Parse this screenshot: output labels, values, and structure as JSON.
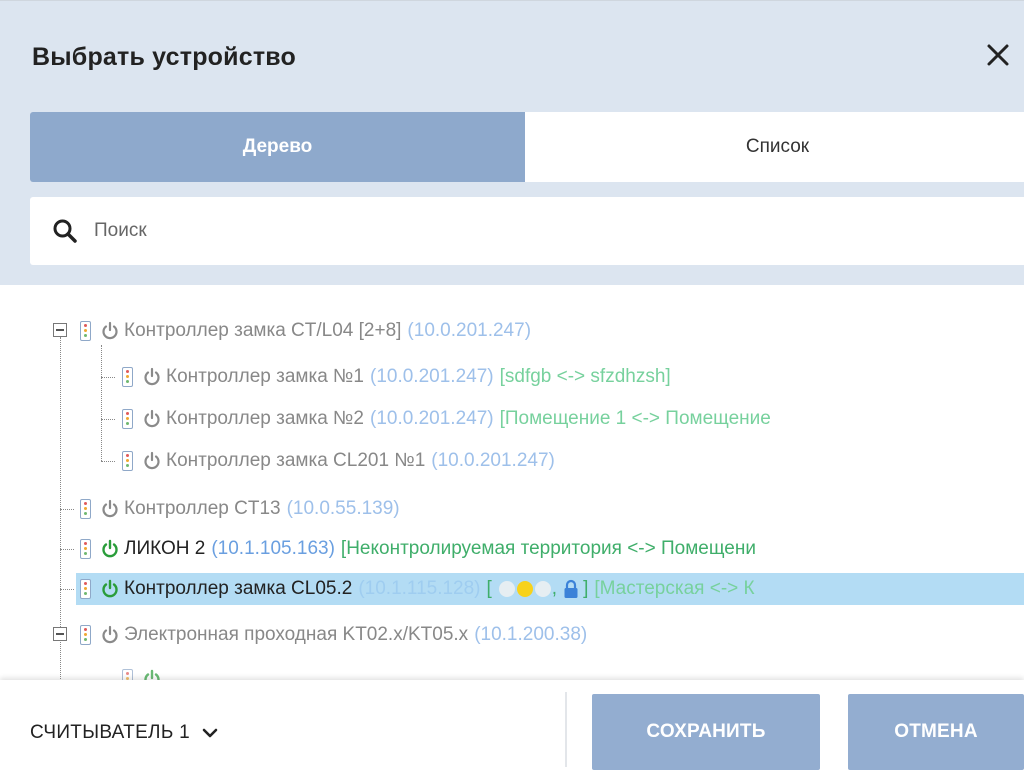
{
  "dialog": {
    "title": "Выбрать устройство",
    "close_icon": "close-icon"
  },
  "tabs": [
    {
      "label": "Дерево",
      "active": true
    },
    {
      "label": "Список",
      "active": false
    }
  ],
  "search": {
    "placeholder": "Поиск",
    "icon": "search-icon"
  },
  "tree": {
    "rows": [
      {
        "name": "Контроллер замка CT/L04 [2+8]",
        "ip": "(10.0.201.247)",
        "zone": "",
        "power": "gray",
        "text_color": "gray"
      },
      {
        "name": "Контроллер замка №1",
        "ip": "(10.0.201.247)",
        "zone": "[sdfgb <-> sfzdhzsh]",
        "power": "gray",
        "text_color": "gray"
      },
      {
        "name": "Контроллер замка №2",
        "ip": "(10.0.201.247)",
        "zone": "[Помещение 1 <-> Помещение",
        "power": "gray",
        "text_color": "gray"
      },
      {
        "name": "Контроллер замка CL201 №1",
        "ip": "(10.0.201.247)",
        "zone": "",
        "power": "gray",
        "text_color": "gray"
      },
      {
        "name": "Контроллер CT13",
        "ip": "(10.0.55.139)",
        "zone": "",
        "power": "gray",
        "text_color": "gray"
      },
      {
        "name": "ЛИКОН 2",
        "ip": "(10.1.105.163)",
        "zone": "[Неконтролируемая территория <-> Помещени",
        "power": "green",
        "text_color": "black"
      },
      {
        "name": "Контроллер замка CL05.2",
        "ip": "(10.1.115.128)",
        "zone": "[Мастерская <-> К",
        "power": "green",
        "text_color": "black",
        "selected": true
      },
      {
        "name": "Электронная проходная KT02.x/KT05.x",
        "ip": "(10.1.200.38)",
        "zone": "",
        "power": "gray",
        "text_color": "gray"
      }
    ],
    "state_colors": {
      "off": "#d9d9d9",
      "on": "#f7d21b",
      "lock": "#3b82d8",
      "power_green": "#2a9d3a",
      "power_gray": "#8a8a8a"
    }
  },
  "footer": {
    "reader_label": "СЧИТЫВАТЕЛЬ 1",
    "save_label": "СОХРАНИТЬ",
    "cancel_label": "ОТМЕНА"
  }
}
